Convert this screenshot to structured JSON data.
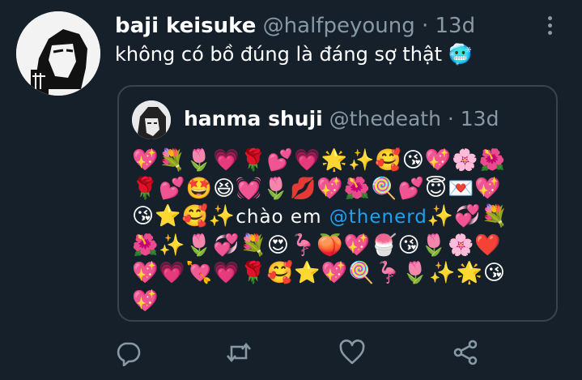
{
  "tweet": {
    "display_name": "baji keisuke",
    "handle": "@halfpeyoung",
    "separator": "·",
    "time": "13d",
    "text": "không có bồ đúng là đáng sợ thật",
    "text_emoji": "🥶"
  },
  "quote": {
    "display_name": "hanma shuji",
    "handle": "@thedeath",
    "separator": "·",
    "time": "13d",
    "line1": "💖💐🌷💗🌹💕💗🌟✨🥰😘💖🌸🌺",
    "line2": "🌹💕🤩😆💓🌷💋💖🌺🍭💕😇💌💖",
    "line3_pre": "😘⭐🥰✨",
    "line3_text": "chào em",
    "line3_mention": "@thenerd",
    "line3_post": "✨💞💐",
    "line4": "🌺✨🌷💞💐😍🦩🍑💖🍧😘🌷🌸❤️",
    "line5": "💖💗💘💗🌹🥰⭐💖🍭🦩🌷✨🌟😘",
    "line6": "💖"
  },
  "icons": {
    "more": "more-vertical-icon",
    "reply": "reply-icon",
    "retweet": "retweet-icon",
    "like": "like-icon",
    "share": "share-icon"
  },
  "colors": {
    "background": "#15202b",
    "secondary_text": "#8899a6",
    "mention": "#1da1f2",
    "border": "#38444d"
  }
}
